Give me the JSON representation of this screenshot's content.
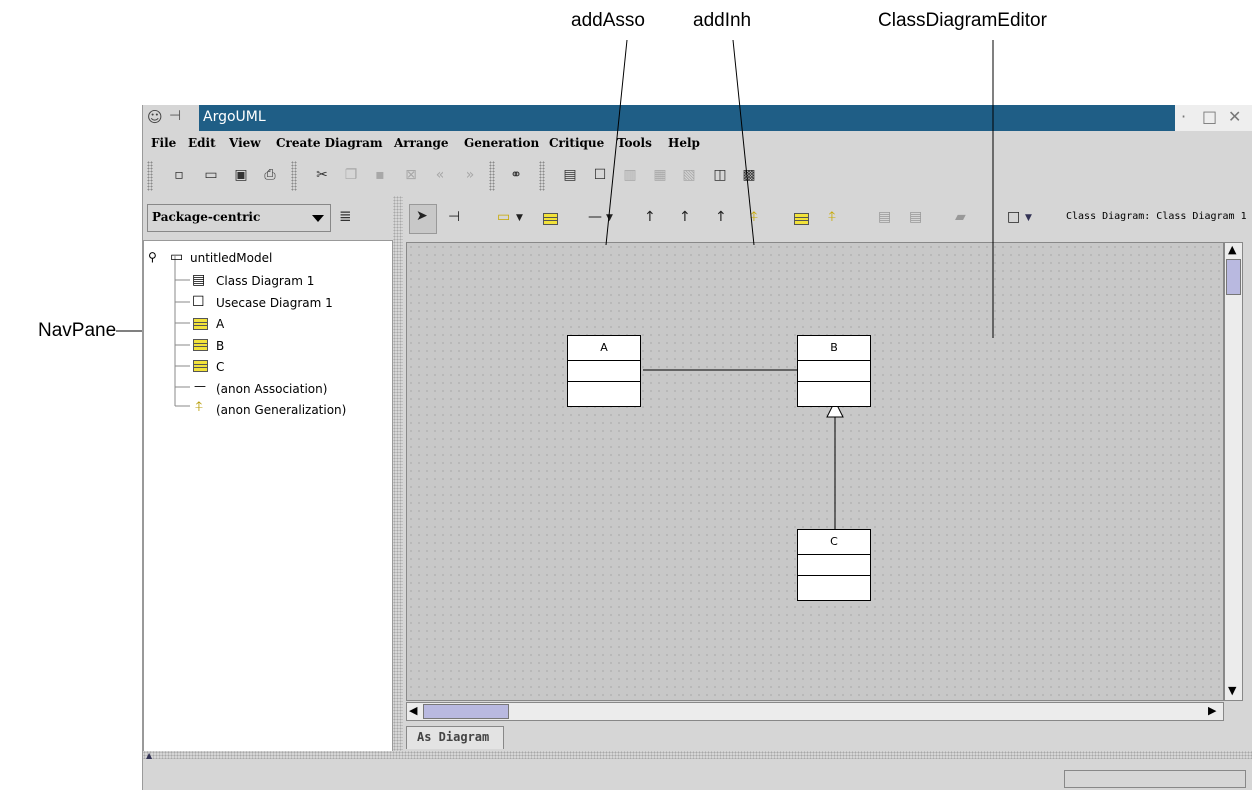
{
  "callouts": {
    "add_asso": "addAsso",
    "add_inh": "addInh",
    "class_diagram_editor": "ClassDiagramEditor",
    "nav_pane": "NavPane"
  },
  "window": {
    "title": "ArgoUML"
  },
  "menubar": {
    "items": [
      "File",
      "Edit",
      "View",
      "Create Diagram",
      "Arrange",
      "Generation",
      "Critique",
      "Tools",
      "Help"
    ]
  },
  "navpane": {
    "perspective": "Package-centric",
    "tree": [
      {
        "label": "untitledModel",
        "icon": "model-package-icon"
      },
      {
        "label": "Class Diagram 1",
        "icon": "class-diagram-icon"
      },
      {
        "label": "Usecase Diagram 1",
        "icon": "usecase-diagram-icon"
      },
      {
        "label": "A",
        "icon": "class-icon"
      },
      {
        "label": "B",
        "icon": "class-icon"
      },
      {
        "label": "C",
        "icon": "class-icon"
      },
      {
        "label": "(anon Association)",
        "icon": "association-icon"
      },
      {
        "label": "(anon Generalization)",
        "icon": "generalization-icon"
      }
    ]
  },
  "editor": {
    "diagram_label": "Class Diagram: Class Diagram 1",
    "tab_label": "As Diagram",
    "classes": {
      "a": "A",
      "b": "B",
      "c": "C"
    }
  },
  "colors": {
    "titlebar": "#1f5e86",
    "class_icon": "#f2e23a",
    "diagram_bg": "#c8c8c8"
  }
}
